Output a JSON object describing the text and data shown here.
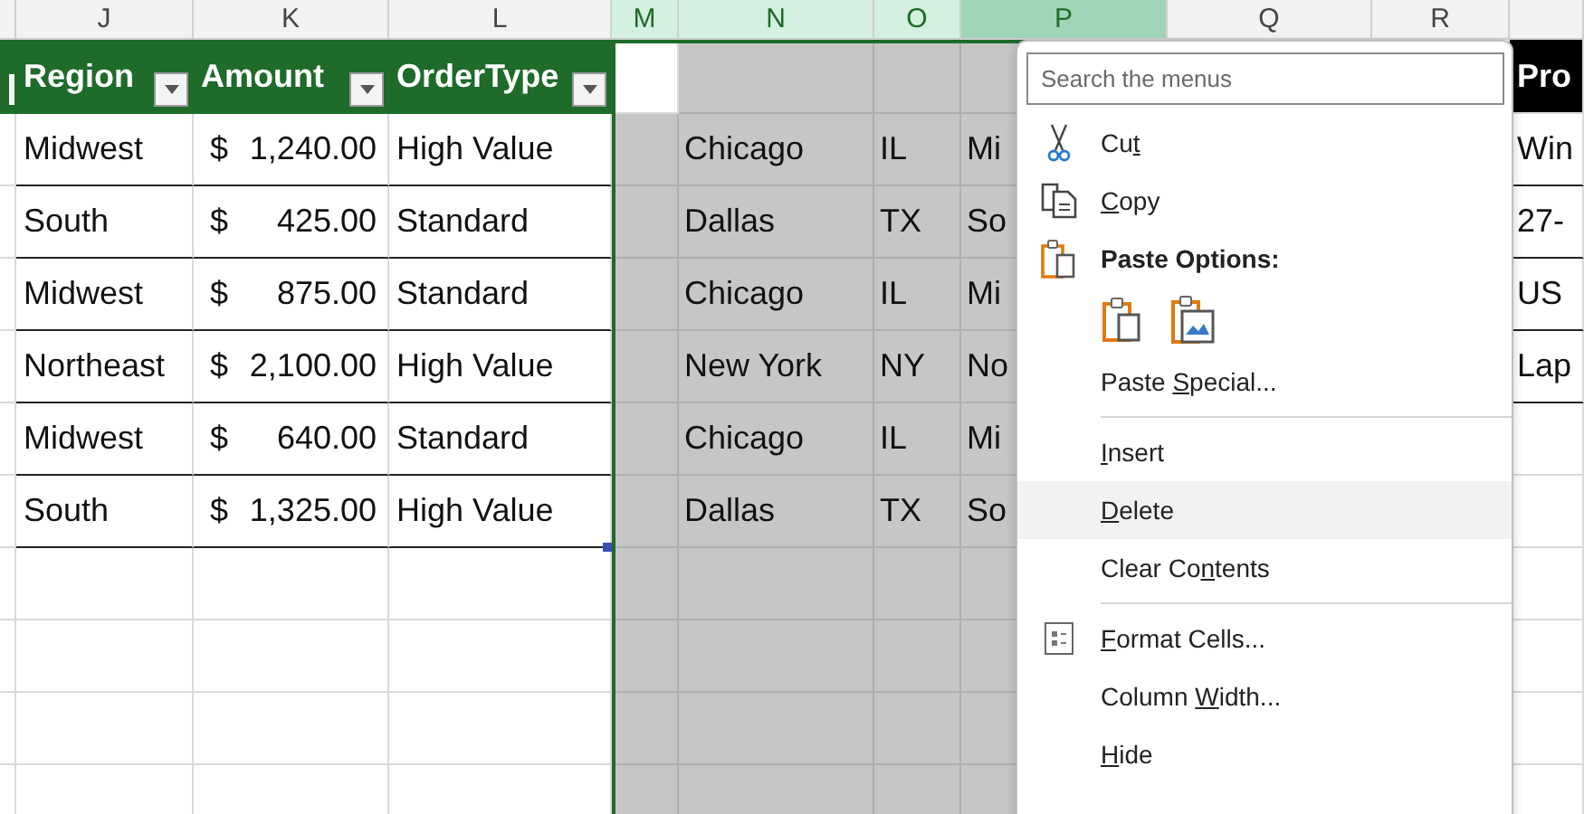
{
  "column_headers": [
    {
      "letter": "J",
      "selected": false,
      "hovered": false
    },
    {
      "letter": "K",
      "selected": false,
      "hovered": false
    },
    {
      "letter": "L",
      "selected": false,
      "hovered": false
    },
    {
      "letter": "M",
      "selected": true,
      "hovered": false
    },
    {
      "letter": "N",
      "selected": true,
      "hovered": false
    },
    {
      "letter": "O",
      "selected": true,
      "hovered": false
    },
    {
      "letter": "P",
      "selected": true,
      "hovered": true
    },
    {
      "letter": "Q",
      "selected": false,
      "hovered": false
    },
    {
      "letter": "R",
      "selected": false,
      "hovered": false
    }
  ],
  "table": {
    "columns": [
      "Region",
      "Amount",
      "OrderType"
    ],
    "column_s_header": "Pro",
    "rows": [
      {
        "region": "Midwest",
        "currency": "$",
        "amount": "1,240.00",
        "order_type": "High Value",
        "city": "Chicago",
        "state": "IL",
        "column_p": "Mi",
        "column_s": "Win"
      },
      {
        "region": "South",
        "currency": "$",
        "amount": "425.00",
        "order_type": "Standard",
        "city": "Dallas",
        "state": "TX",
        "column_p": "So",
        "column_s": "27-"
      },
      {
        "region": "Midwest",
        "currency": "$",
        "amount": "875.00",
        "order_type": "Standard",
        "city": "Chicago",
        "state": "IL",
        "column_p": "Mi",
        "column_s": "US"
      },
      {
        "region": "Northeast",
        "currency": "$",
        "amount": "2,100.00",
        "order_type": "High Value",
        "city": "New York",
        "state": "NY",
        "column_p": "No",
        "column_s": "Lap"
      },
      {
        "region": "Midwest",
        "currency": "$",
        "amount": "640.00",
        "order_type": "Standard",
        "city": "Chicago",
        "state": "IL",
        "column_p": "Mi"
      },
      {
        "region": "South",
        "currency": "$",
        "amount": "1,325.00",
        "order_type": "High Value",
        "city": "Dallas",
        "state": "TX",
        "column_p": "So"
      }
    ]
  },
  "context_menu": {
    "search": {
      "placeholder": "Search the menus"
    },
    "items": [
      {
        "kind": "cut",
        "before": "Cu",
        "access_key": "t",
        "highlighted": false
      },
      {
        "kind": "copy",
        "access_key": "C",
        "after": "opy",
        "highlighted": false
      },
      {
        "kind": "paste_heading",
        "before": "Paste Options:",
        "highlighted": false
      },
      {
        "kind": "paste_buttons"
      },
      {
        "kind": "plain",
        "before": "Paste ",
        "access_key": "S",
        "after": "pecial...",
        "highlighted": false
      },
      {
        "kind": "separator"
      },
      {
        "kind": "plain",
        "access_key": "I",
        "after": "nsert",
        "highlighted": false
      },
      {
        "kind": "plain",
        "access_key": "D",
        "after": "elete",
        "highlighted": true
      },
      {
        "kind": "plain",
        "before": "Clear Co",
        "access_key": "n",
        "after": "tents",
        "highlighted": false
      },
      {
        "kind": "separator"
      },
      {
        "kind": "format",
        "access_key": "F",
        "after": "ormat Cells...",
        "highlighted": false
      },
      {
        "kind": "plain",
        "before": "Column ",
        "access_key": "W",
        "after": "idth...",
        "highlighted": false
      },
      {
        "kind": "plain",
        "access_key": "H",
        "after": "ide",
        "highlighted": false
      }
    ]
  }
}
